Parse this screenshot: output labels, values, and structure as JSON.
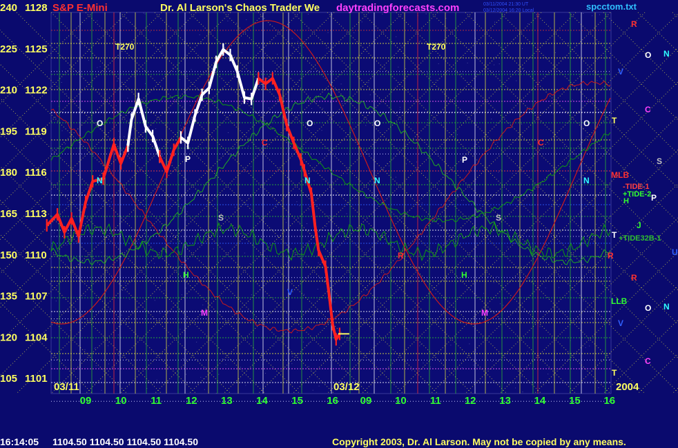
{
  "header": {
    "title_left": "S&P E-Mini",
    "title_center": "Dr. Al Larson's Chaos Trader We",
    "site": "daytradingforecasts.com",
    "file": "spcctom.txt",
    "stamp_line1": "03/11/2004 21:30 UT",
    "stamp_line2": "03/12/2004 16:20 Local"
  },
  "footer": {
    "time": "16:14:05",
    "quote": "1104.50 1104.50 1104.50 1104.50",
    "copyright": "Copyright 2003, Dr. Al Larson. May not be copied by any means."
  },
  "colors": {
    "background": "#0a0a6e",
    "price_white": "#ffffff",
    "price_red": "#ff2020",
    "green_line": "#22aa22",
    "dark_green": "#109a10",
    "red_line": "#cc1a1a",
    "yellow_grid": "#e6e640",
    "title_red": "#ff3030",
    "title_yellow": "#ffff60",
    "site_magenta": "#ff40ff",
    "file_cyan": "#30c0ff",
    "axis_yellow": "#ffff60",
    "hour_green": "#30ff30"
  },
  "chart_data": {
    "type": "line",
    "title": "S&P E-Mini",
    "left_axis_ticks": [
      "240",
      "225",
      "210",
      "195",
      "180",
      "165",
      "150",
      "135",
      "120",
      "105"
    ],
    "price_axis_ticks": [
      "1128",
      "1125",
      "1122",
      "1119",
      "1116",
      "1113",
      "1110",
      "1107",
      "1104",
      "1101"
    ],
    "ylim": [
      1101,
      1128
    ],
    "x_hour_ticks": [
      "09",
      "10",
      "11",
      "12",
      "13",
      "14",
      "15",
      "16",
      "09",
      "10",
      "11",
      "12",
      "13",
      "14",
      "15",
      "16"
    ],
    "date_labels": [
      "03/11",
      "03/12",
      "2004"
    ],
    "last_price": 1104.5,
    "price_series": [
      {
        "name": "",
        "color": "red",
        "points": [
          [
            7.9,
            1112.4
          ],
          [
            8.2,
            1113.2
          ],
          [
            8.4,
            1111.9
          ],
          [
            8.6,
            1112.9
          ],
          [
            8.8,
            1111.6
          ],
          [
            9.0,
            1114.1
          ],
          [
            9.2,
            1115.6
          ],
          [
            9.5,
            1115.8
          ],
          [
            9.8,
            1118.3
          ],
          [
            10.0,
            1116.9
          ],
          [
            10.2,
            1118.2
          ]
        ]
      },
      {
        "name": "",
        "color": "white",
        "points": [
          [
            10.2,
            1118.2
          ],
          [
            10.3,
            1120.1
          ],
          [
            10.5,
            1121.6
          ],
          [
            10.7,
            1119.6
          ],
          [
            10.9,
            1118.9
          ],
          [
            11.1,
            1117.4
          ]
        ]
      },
      {
        "name": "",
        "color": "red",
        "points": [
          [
            11.1,
            1117.4
          ],
          [
            11.3,
            1116.3
          ],
          [
            11.5,
            1117.9
          ],
          [
            11.7,
            1118.8
          ]
        ]
      },
      {
        "name": "",
        "color": "white",
        "points": [
          [
            11.7,
            1118.8
          ],
          [
            11.9,
            1118.4
          ],
          [
            12.1,
            1120.4
          ],
          [
            12.3,
            1121.9
          ],
          [
            12.5,
            1122.4
          ],
          [
            12.7,
            1124.3
          ],
          [
            12.9,
            1125.2
          ],
          [
            13.1,
            1124.8
          ],
          [
            13.3,
            1123.6
          ],
          [
            13.5,
            1121.7
          ],
          [
            13.7,
            1121.6
          ],
          [
            13.9,
            1123.1
          ]
        ]
      },
      {
        "name": "",
        "color": "red",
        "points": [
          [
            13.9,
            1123.1
          ],
          [
            14.1,
            1122.7
          ],
          [
            14.3,
            1123.1
          ],
          [
            14.5,
            1121.9
          ],
          [
            14.7,
            1119.7
          ],
          [
            14.9,
            1118.4
          ],
          [
            15.1,
            1117.2
          ],
          [
            15.2,
            1116.4
          ],
          [
            15.4,
            1114.7
          ],
          [
            15.5,
            1112.4
          ],
          [
            15.6,
            1110.6
          ],
          [
            15.8,
            1109.4
          ],
          [
            15.9,
            1107.4
          ],
          [
            16.0,
            1105.2
          ],
          [
            16.1,
            1104.1
          ],
          [
            16.2,
            1104.5
          ]
        ]
      }
    ],
    "series": [
      {
        "name": "-TIDE-1",
        "color": "red"
      },
      {
        "name": "+TIDE-2",
        "color": "green"
      },
      {
        "name": "+TIDE32B-1",
        "color": "green"
      }
    ],
    "right_markers": [
      "R",
      "O",
      "N",
      "V",
      "C",
      "T",
      "S",
      "MLB",
      "-TIDE-1",
      "+TIDE-2",
      "H",
      "P",
      "J",
      "T",
      "+TIDE32B-1",
      "U",
      "R",
      "R",
      "LLB",
      "O",
      "N",
      "V",
      "C",
      "T"
    ],
    "chart_annotations": [
      "T270",
      "T270",
      "O",
      "O",
      "O",
      "O",
      "N",
      "N",
      "N",
      "N",
      "P",
      "P",
      "S",
      "S",
      "R",
      "C",
      "C",
      "H",
      "H",
      "M",
      "M",
      "V"
    ]
  }
}
